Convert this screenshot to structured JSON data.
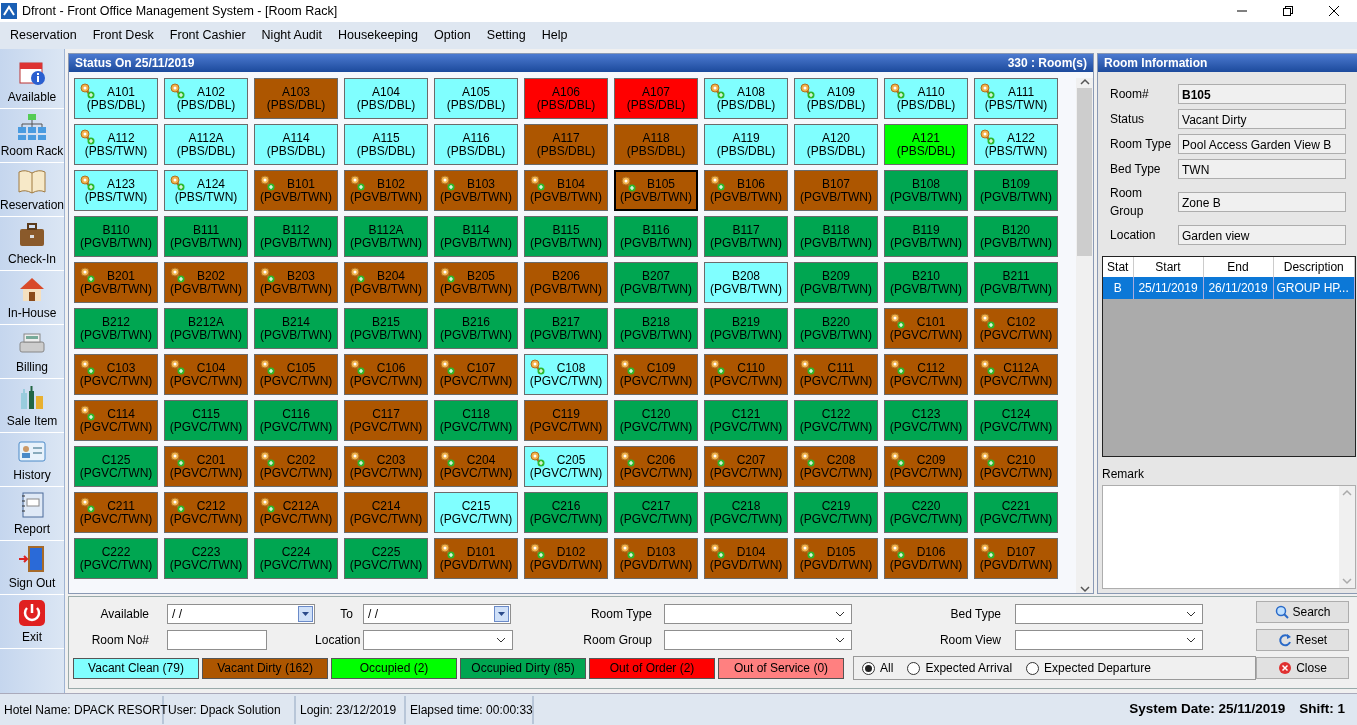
{
  "window": {
    "title": "Dfront - Front Office Management System - [Room Rack]"
  },
  "menu": [
    "Reservation",
    "Front Desk",
    "Front Cashier",
    "Night Audit",
    "Housekeeping",
    "Option",
    "Setting",
    "Help"
  ],
  "sidebar": [
    {
      "label": "Available",
      "kind": "available"
    },
    {
      "label": "Room Rack",
      "kind": "rack"
    },
    {
      "label": "Reservation",
      "kind": "book"
    },
    {
      "label": "Check-In",
      "kind": "case"
    },
    {
      "label": "In-House",
      "kind": "house"
    },
    {
      "label": "Billing",
      "kind": "register"
    },
    {
      "label": "Sale Item",
      "kind": "bottles"
    },
    {
      "label": "History",
      "kind": "card"
    },
    {
      "label": "Report",
      "kind": "report"
    },
    {
      "label": "Sign Out",
      "kind": "door"
    },
    {
      "label": "Exit",
      "kind": "power"
    }
  ],
  "rack": {
    "title": "Status On 25/11/2019",
    "count": "330 : Room(s)"
  },
  "rooms": [
    {
      "room": "A101",
      "type": "(PBS/DBL)",
      "color": "#80ffff",
      "key": true,
      "selected": false
    },
    {
      "room": "A102",
      "type": "(PBS/DBL)",
      "color": "#80ffff",
      "key": true,
      "selected": false
    },
    {
      "room": "A103",
      "type": "(PBS/DBL)",
      "color": "#ad5600",
      "key": false,
      "selected": false
    },
    {
      "room": "A104",
      "type": "(PBS/DBL)",
      "color": "#80ffff",
      "key": false,
      "selected": false
    },
    {
      "room": "A105",
      "type": "(PBS/DBL)",
      "color": "#80ffff",
      "key": false,
      "selected": false
    },
    {
      "room": "A106",
      "type": "(PBS/DBL)",
      "color": "#ff0000",
      "key": false,
      "selected": false
    },
    {
      "room": "A107",
      "type": "(PBS/DBL)",
      "color": "#ff0000",
      "key": false,
      "selected": false
    },
    {
      "room": "A108",
      "type": "(PBS/DBL)",
      "color": "#80ffff",
      "key": true,
      "selected": false
    },
    {
      "room": "A109",
      "type": "(PBS/DBL)",
      "color": "#80ffff",
      "key": true,
      "selected": false
    },
    {
      "room": "A110",
      "type": "(PBS/DBL)",
      "color": "#80ffff",
      "key": true,
      "selected": false
    },
    {
      "room": "A111",
      "type": "(PBS/TWN)",
      "color": "#80ffff",
      "key": true,
      "selected": false
    },
    {
      "room": "A112",
      "type": "(PBS/TWN)",
      "color": "#80ffff",
      "key": true,
      "selected": false
    },
    {
      "room": "A112A",
      "type": "(PBS/DBL)",
      "color": "#80ffff",
      "key": false,
      "selected": false
    },
    {
      "room": "A114",
      "type": "(PBS/DBL)",
      "color": "#80ffff",
      "key": false,
      "selected": false
    },
    {
      "room": "A115",
      "type": "(PBS/DBL)",
      "color": "#80ffff",
      "key": false,
      "selected": false
    },
    {
      "room": "A116",
      "type": "(PBS/DBL)",
      "color": "#80ffff",
      "key": false,
      "selected": false
    },
    {
      "room": "A117",
      "type": "(PBS/DBL)",
      "color": "#ad5600",
      "key": false,
      "selected": false
    },
    {
      "room": "A118",
      "type": "(PBS/DBL)",
      "color": "#ad5600",
      "key": false,
      "selected": false
    },
    {
      "room": "A119",
      "type": "(PBS/DBL)",
      "color": "#80ffff",
      "key": false,
      "selected": false
    },
    {
      "room": "A120",
      "type": "(PBS/DBL)",
      "color": "#80ffff",
      "key": false,
      "selected": false
    },
    {
      "room": "A121",
      "type": "(PBS/DBL)",
      "color": "#00ff00",
      "key": false,
      "selected": false
    },
    {
      "room": "A122",
      "type": "(PBS/TWN)",
      "color": "#80ffff",
      "key": true,
      "selected": false
    },
    {
      "room": "A123",
      "type": "(PBS/TWN)",
      "color": "#80ffff",
      "key": true,
      "selected": false
    },
    {
      "room": "A124",
      "type": "(PBS/TWN)",
      "color": "#80ffff",
      "key": true,
      "selected": false
    },
    {
      "room": "B101",
      "type": "(PGVB/TWN)",
      "color": "#ad5600",
      "key": true,
      "selected": false
    },
    {
      "room": "B102",
      "type": "(PGVB/TWN)",
      "color": "#ad5600",
      "key": true,
      "selected": false
    },
    {
      "room": "B103",
      "type": "(PGVB/TWN)",
      "color": "#ad5600",
      "key": true,
      "selected": false
    },
    {
      "room": "B104",
      "type": "(PGVB/TWN)",
      "color": "#ad5600",
      "key": true,
      "selected": false
    },
    {
      "room": "B105",
      "type": "(PGVB/TWN)",
      "color": "#ad5600",
      "key": true,
      "selected": true
    },
    {
      "room": "B106",
      "type": "(PGVB/TWN)",
      "color": "#ad5600",
      "key": true,
      "selected": false
    },
    {
      "room": "B107",
      "type": "(PGVB/TWN)",
      "color": "#ad5600",
      "key": false,
      "selected": false
    },
    {
      "room": "B108",
      "type": "(PGVB/TWN)",
      "color": "#00a651",
      "key": false,
      "selected": false
    },
    {
      "room": "B109",
      "type": "(PGVB/TWN)",
      "color": "#00a651",
      "key": false,
      "selected": false
    },
    {
      "room": "B110",
      "type": "(PGVB/TWN)",
      "color": "#00a651",
      "key": false,
      "selected": false
    },
    {
      "room": "B111",
      "type": "(PGVB/TWN)",
      "color": "#00a651",
      "key": false,
      "selected": false
    },
    {
      "room": "B112",
      "type": "(PGVB/TWN)",
      "color": "#00a651",
      "key": false,
      "selected": false
    },
    {
      "room": "B112A",
      "type": "(PGVB/TWN)",
      "color": "#00a651",
      "key": false,
      "selected": false
    },
    {
      "room": "B114",
      "type": "(PGVB/TWN)",
      "color": "#00a651",
      "key": false,
      "selected": false
    },
    {
      "room": "B115",
      "type": "(PGVB/TWN)",
      "color": "#00a651",
      "key": false,
      "selected": false
    },
    {
      "room": "B116",
      "type": "(PGVB/TWN)",
      "color": "#00a651",
      "key": false,
      "selected": false
    },
    {
      "room": "B117",
      "type": "(PGVB/TWN)",
      "color": "#00a651",
      "key": false,
      "selected": false
    },
    {
      "room": "B118",
      "type": "(PGVB/TWN)",
      "color": "#00a651",
      "key": false,
      "selected": false
    },
    {
      "room": "B119",
      "type": "(PGVB/TWN)",
      "color": "#00a651",
      "key": false,
      "selected": false
    },
    {
      "room": "B120",
      "type": "(PGVB/TWN)",
      "color": "#00a651",
      "key": false,
      "selected": false
    },
    {
      "room": "B201",
      "type": "(PGVB/TWN)",
      "color": "#ad5600",
      "key": true,
      "selected": false
    },
    {
      "room": "B202",
      "type": "(PGVB/TWN)",
      "color": "#ad5600",
      "key": true,
      "selected": false
    },
    {
      "room": "B203",
      "type": "(PGVB/TWN)",
      "color": "#ad5600",
      "key": true,
      "selected": false
    },
    {
      "room": "B204",
      "type": "(PGVB/TWN)",
      "color": "#ad5600",
      "key": true,
      "selected": false
    },
    {
      "room": "B205",
      "type": "(PGVB/TWN)",
      "color": "#ad5600",
      "key": true,
      "selected": false
    },
    {
      "room": "B206",
      "type": "(PGVB/TWN)",
      "color": "#ad5600",
      "key": false,
      "selected": false
    },
    {
      "room": "B207",
      "type": "(PGVB/TWN)",
      "color": "#00a651",
      "key": false,
      "selected": false
    },
    {
      "room": "B208",
      "type": "(PGVB/TWN)",
      "color": "#80ffff",
      "key": false,
      "selected": false
    },
    {
      "room": "B209",
      "type": "(PGVB/TWN)",
      "color": "#00a651",
      "key": false,
      "selected": false
    },
    {
      "room": "B210",
      "type": "(PGVB/TWN)",
      "color": "#00a651",
      "key": false,
      "selected": false
    },
    {
      "room": "B211",
      "type": "(PGVB/TWN)",
      "color": "#00a651",
      "key": false,
      "selected": false
    },
    {
      "room": "B212",
      "type": "(PGVB/TWN)",
      "color": "#00a651",
      "key": false,
      "selected": false
    },
    {
      "room": "B212A",
      "type": "(PGVB/TWN)",
      "color": "#00a651",
      "key": false,
      "selected": false
    },
    {
      "room": "B214",
      "type": "(PGVB/TWN)",
      "color": "#00a651",
      "key": false,
      "selected": false
    },
    {
      "room": "B215",
      "type": "(PGVB/TWN)",
      "color": "#00a651",
      "key": false,
      "selected": false
    },
    {
      "room": "B216",
      "type": "(PGVB/TWN)",
      "color": "#00a651",
      "key": false,
      "selected": false
    },
    {
      "room": "B217",
      "type": "(PGVB/TWN)",
      "color": "#00a651",
      "key": false,
      "selected": false
    },
    {
      "room": "B218",
      "type": "(PGVB/TWN)",
      "color": "#00a651",
      "key": false,
      "selected": false
    },
    {
      "room": "B219",
      "type": "(PGVB/TWN)",
      "color": "#00a651",
      "key": false,
      "selected": false
    },
    {
      "room": "B220",
      "type": "(PGVB/TWN)",
      "color": "#00a651",
      "key": false,
      "selected": false
    },
    {
      "room": "C101",
      "type": "(PGVC/TWN)",
      "color": "#ad5600",
      "key": true,
      "selected": false
    },
    {
      "room": "C102",
      "type": "(PGVC/TWN)",
      "color": "#ad5600",
      "key": true,
      "selected": false
    },
    {
      "room": "C103",
      "type": "(PGVC/TWN)",
      "color": "#ad5600",
      "key": true,
      "selected": false
    },
    {
      "room": "C104",
      "type": "(PGVC/TWN)",
      "color": "#ad5600",
      "key": true,
      "selected": false
    },
    {
      "room": "C105",
      "type": "(PGVC/TWN)",
      "color": "#ad5600",
      "key": true,
      "selected": false
    },
    {
      "room": "C106",
      "type": "(PGVC/TWN)",
      "color": "#ad5600",
      "key": true,
      "selected": false
    },
    {
      "room": "C107",
      "type": "(PGVC/TWN)",
      "color": "#ad5600",
      "key": true,
      "selected": false
    },
    {
      "room": "C108",
      "type": "(PGVC/TWN)",
      "color": "#80ffff",
      "key": true,
      "selected": false
    },
    {
      "room": "C109",
      "type": "(PGVC/TWN)",
      "color": "#ad5600",
      "key": true,
      "selected": false
    },
    {
      "room": "C110",
      "type": "(PGVC/TWN)",
      "color": "#ad5600",
      "key": true,
      "selected": false
    },
    {
      "room": "C111",
      "type": "(PGVC/TWN)",
      "color": "#ad5600",
      "key": true,
      "selected": false
    },
    {
      "room": "C112",
      "type": "(PGVC/TWN)",
      "color": "#ad5600",
      "key": true,
      "selected": false
    },
    {
      "room": "C112A",
      "type": "(PGVC/TWN)",
      "color": "#ad5600",
      "key": true,
      "selected": false
    },
    {
      "room": "C114",
      "type": "(PGVC/TWN)",
      "color": "#ad5600",
      "key": true,
      "selected": false
    },
    {
      "room": "C115",
      "type": "(PGVC/TWN)",
      "color": "#00a651",
      "key": false,
      "selected": false
    },
    {
      "room": "C116",
      "type": "(PGVC/TWN)",
      "color": "#00a651",
      "key": false,
      "selected": false
    },
    {
      "room": "C117",
      "type": "(PGVC/TWN)",
      "color": "#ad5600",
      "key": false,
      "selected": false
    },
    {
      "room": "C118",
      "type": "(PGVC/TWN)",
      "color": "#00a651",
      "key": false,
      "selected": false
    },
    {
      "room": "C119",
      "type": "(PGVC/TWN)",
      "color": "#ad5600",
      "key": false,
      "selected": false
    },
    {
      "room": "C120",
      "type": "(PGVC/TWN)",
      "color": "#00a651",
      "key": false,
      "selected": false
    },
    {
      "room": "C121",
      "type": "(PGVC/TWN)",
      "color": "#00a651",
      "key": false,
      "selected": false
    },
    {
      "room": "C122",
      "type": "(PGVC/TWN)",
      "color": "#00a651",
      "key": false,
      "selected": false
    },
    {
      "room": "C123",
      "type": "(PGVC/TWN)",
      "color": "#00a651",
      "key": false,
      "selected": false
    },
    {
      "room": "C124",
      "type": "(PGVC/TWN)",
      "color": "#00a651",
      "key": false,
      "selected": false
    },
    {
      "room": "C125",
      "type": "(PGVC/TWN)",
      "color": "#00a651",
      "key": false,
      "selected": false
    },
    {
      "room": "C201",
      "type": "(PGVC/TWN)",
      "color": "#ad5600",
      "key": true,
      "selected": false
    },
    {
      "room": "C202",
      "type": "(PGVC/TWN)",
      "color": "#ad5600",
      "key": true,
      "selected": false
    },
    {
      "room": "C203",
      "type": "(PGVC/TWN)",
      "color": "#ad5600",
      "key": true,
      "selected": false
    },
    {
      "room": "C204",
      "type": "(PGVC/TWN)",
      "color": "#ad5600",
      "key": true,
      "selected": false
    },
    {
      "room": "C205",
      "type": "(PGVC/TWN)",
      "color": "#80ffff",
      "key": true,
      "selected": false
    },
    {
      "room": "C206",
      "type": "(PGVC/TWN)",
      "color": "#ad5600",
      "key": true,
      "selected": false
    },
    {
      "room": "C207",
      "type": "(PGVC/TWN)",
      "color": "#ad5600",
      "key": true,
      "selected": false
    },
    {
      "room": "C208",
      "type": "(PGVC/TWN)",
      "color": "#ad5600",
      "key": true,
      "selected": false
    },
    {
      "room": "C209",
      "type": "(PGVC/TWN)",
      "color": "#ad5600",
      "key": true,
      "selected": false
    },
    {
      "room": "C210",
      "type": "(PGVC/TWN)",
      "color": "#ad5600",
      "key": true,
      "selected": false
    },
    {
      "room": "C211",
      "type": "(PGVC/TWN)",
      "color": "#ad5600",
      "key": true,
      "selected": false
    },
    {
      "room": "C212",
      "type": "(PGVC/TWN)",
      "color": "#ad5600",
      "key": true,
      "selected": false
    },
    {
      "room": "C212A",
      "type": "(PGVC/TWN)",
      "color": "#ad5600",
      "key": true,
      "selected": false
    },
    {
      "room": "C214",
      "type": "(PGVC/TWN)",
      "color": "#ad5600",
      "key": false,
      "selected": false
    },
    {
      "room": "C215",
      "type": "(PGVC/TWN)",
      "color": "#80ffff",
      "key": false,
      "selected": false
    },
    {
      "room": "C216",
      "type": "(PGVC/TWN)",
      "color": "#00a651",
      "key": false,
      "selected": false
    },
    {
      "room": "C217",
      "type": "(PGVC/TWN)",
      "color": "#00a651",
      "key": false,
      "selected": false
    },
    {
      "room": "C218",
      "type": "(PGVC/TWN)",
      "color": "#00a651",
      "key": false,
      "selected": false
    },
    {
      "room": "C219",
      "type": "(PGVC/TWN)",
      "color": "#00a651",
      "key": false,
      "selected": false
    },
    {
      "room": "C220",
      "type": "(PGVC/TWN)",
      "color": "#00a651",
      "key": false,
      "selected": false
    },
    {
      "room": "C221",
      "type": "(PGVC/TWN)",
      "color": "#00a651",
      "key": false,
      "selected": false
    },
    {
      "room": "C222",
      "type": "(PGVC/TWN)",
      "color": "#00a651",
      "key": false,
      "selected": false
    },
    {
      "room": "C223",
      "type": "(PGVC/TWN)",
      "color": "#00a651",
      "key": false,
      "selected": false
    },
    {
      "room": "C224",
      "type": "(PGVC/TWN)",
      "color": "#00a651",
      "key": false,
      "selected": false
    },
    {
      "room": "C225",
      "type": "(PGVC/TWN)",
      "color": "#00a651",
      "key": false,
      "selected": false
    },
    {
      "room": "D101",
      "type": "(PGVD/TWN)",
      "color": "#ad5600",
      "key": true,
      "selected": false
    },
    {
      "room": "D102",
      "type": "(PGVD/TWN)",
      "color": "#ad5600",
      "key": true,
      "selected": false
    },
    {
      "room": "D103",
      "type": "(PGVD/TWN)",
      "color": "#ad5600",
      "key": true,
      "selected": false
    },
    {
      "room": "D104",
      "type": "(PGVD/TWN)",
      "color": "#ad5600",
      "key": true,
      "selected": false
    },
    {
      "room": "D105",
      "type": "(PGVD/TWN)",
      "color": "#ad5600",
      "key": true,
      "selected": false
    },
    {
      "room": "D106",
      "type": "(PGVD/TWN)",
      "color": "#ad5600",
      "key": true,
      "selected": false
    },
    {
      "room": "D107",
      "type": "(PGVD/TWN)",
      "color": "#ad5600",
      "key": true,
      "selected": false
    }
  ],
  "room_info": {
    "title": "Room Information",
    "fields": [
      {
        "label": "Room#",
        "value": "B105"
      },
      {
        "label": "Status",
        "value": "Vacant Dirty"
      },
      {
        "label": "Room Type",
        "value": "Pool Access Garden View B"
      },
      {
        "label": "Bed Type",
        "value": "TWN"
      },
      {
        "label": "Room Group",
        "value": "Zone B"
      },
      {
        "label": "Location",
        "value": "Garden view"
      }
    ],
    "table": {
      "columns": [
        "Stat",
        "Start",
        "End",
        "Description"
      ],
      "rows": [
        {
          "cells": [
            "B",
            "25/11/2019",
            "26/11/2019",
            "GROUP HP..."
          ],
          "selected": true
        }
      ]
    },
    "remark_label": "Remark"
  },
  "filters": {
    "available": {
      "label": "Available",
      "value": "/  /"
    },
    "to": {
      "label": "To",
      "value": "/  /"
    },
    "room_type": {
      "label": "Room Type"
    },
    "bed_type": {
      "label": "Bed Type"
    },
    "room_no": {
      "label": "Room No#"
    },
    "location": {
      "label": "Location"
    },
    "room_group": {
      "label": "Room Group"
    },
    "room_view": {
      "label": "Room View"
    }
  },
  "legend": [
    {
      "label": "Vacant Clean (79)",
      "color": "#80ffff"
    },
    {
      "label": "Vacant Dirty (162)",
      "color": "#ad5600"
    },
    {
      "label": "Occupied (2)",
      "color": "#00ff00"
    },
    {
      "label": "Occupied Dirty (85)",
      "color": "#00a651"
    },
    {
      "label": "Out of Order (2)",
      "color": "#ff0000"
    },
    {
      "label": "Out of Service (0)",
      "color": "#ff8080"
    }
  ],
  "expected": [
    {
      "label": "All",
      "selected": true
    },
    {
      "label": "Expected Arrival",
      "selected": false
    },
    {
      "label": "Expected Departure",
      "selected": false
    }
  ],
  "buttons": [
    {
      "label": "Search",
      "kind": "search"
    },
    {
      "label": "Reset",
      "kind": "reset"
    },
    {
      "label": "Close",
      "kind": "close"
    }
  ],
  "status_bar": {
    "hotel": "Hotel Name: DPACK RESORT",
    "user": "User: Dpack Solution",
    "login": "Login: 23/12/2019",
    "elapsed": "Elapsed time: 00:00:33",
    "system_date": "System Date: 25/11/2019",
    "shift": "Shift: 1"
  }
}
